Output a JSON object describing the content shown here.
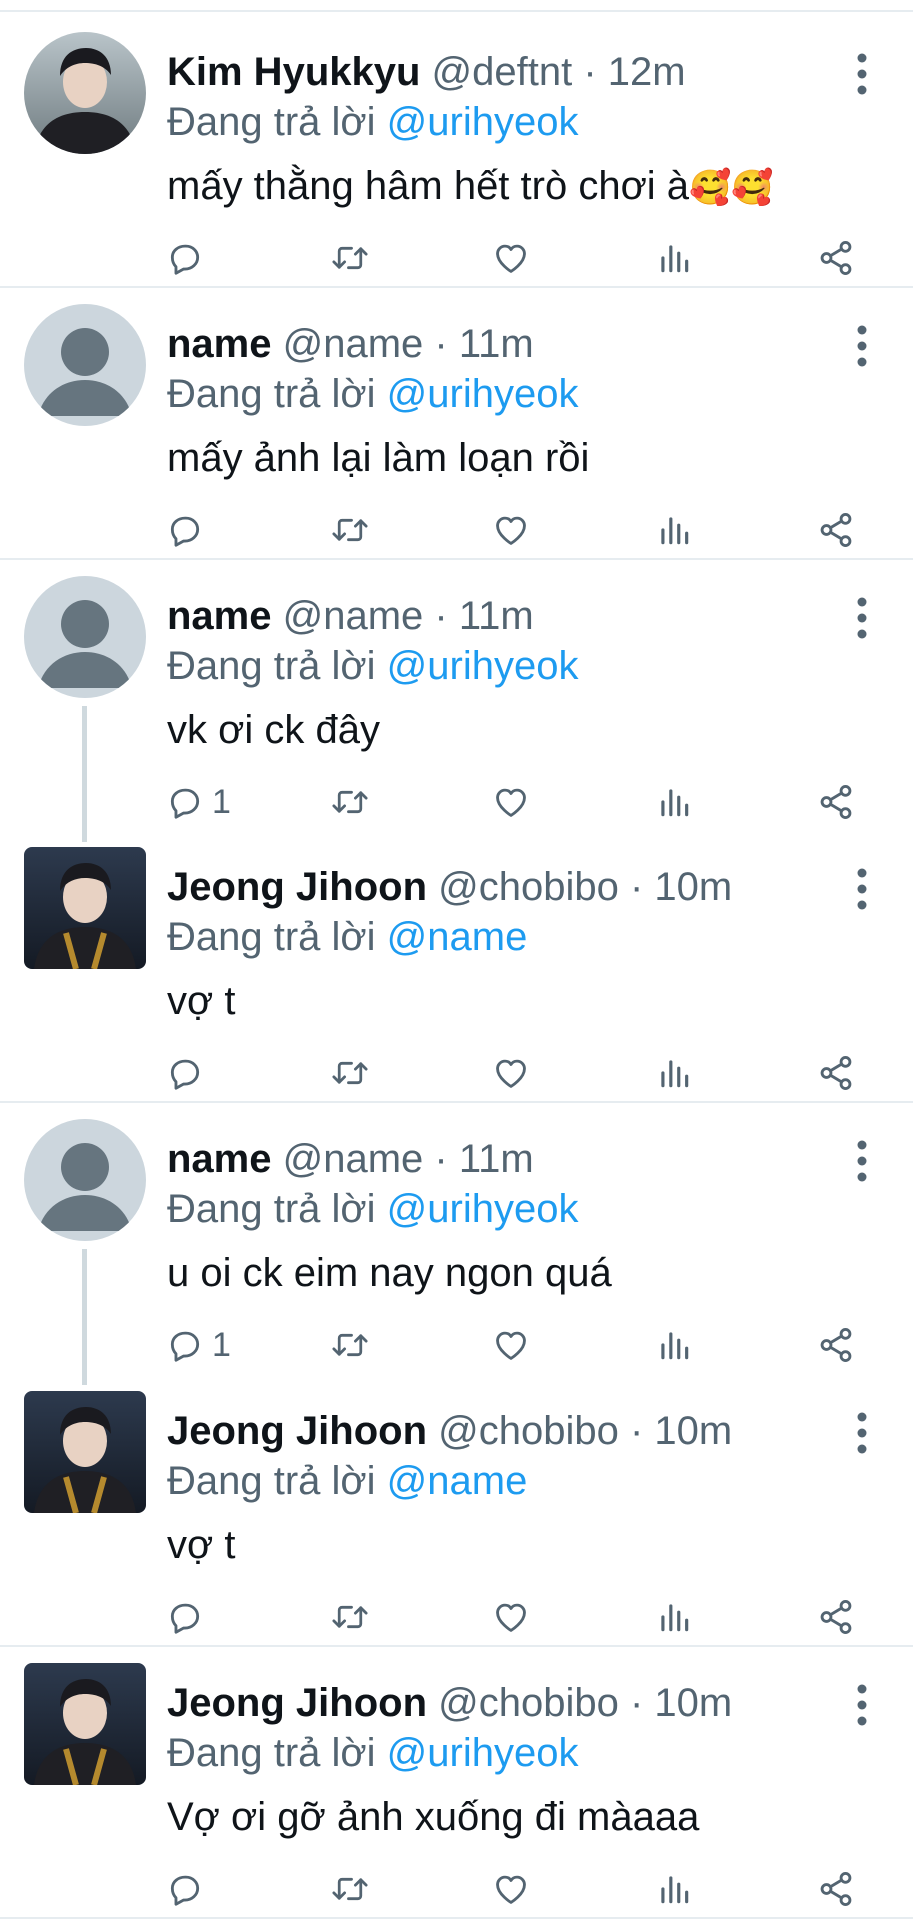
{
  "labels": {
    "replying_prefix": "Đang trả lời ",
    "dot": " · "
  },
  "tweets": [
    {
      "name": "Kim Hyukkyu",
      "handle": "@deftnt",
      "time": "12m",
      "reply_to": "@urihyeok",
      "text": "mấy thằng hâm hết trò chơi à",
      "emoji": "🥰🥰",
      "avatar": "photo-avatar",
      "reply_count": "",
      "thread": false
    },
    {
      "name": "name",
      "handle": "@name",
      "time": "11m",
      "reply_to": "@urihyeok",
      "text": "mấy ảnh lại làm loạn rồi",
      "emoji": "",
      "avatar": "default-avatar",
      "reply_count": "",
      "thread": false
    },
    {
      "name": "name",
      "handle": "@name",
      "time": "11m",
      "reply_to": "@urihyeok",
      "text": "vk ơi ck đây",
      "emoji": "",
      "avatar": "default-avatar",
      "reply_count": "1",
      "thread": true
    },
    {
      "name": "Jeong Jihoon",
      "handle": "@chobibo",
      "time": "10m",
      "reply_to": "@name",
      "text": "vợ t",
      "emoji": "",
      "avatar": "photo-avatar",
      "reply_count": "",
      "thread": false
    },
    {
      "name": "name",
      "handle": "@name",
      "time": "11m",
      "reply_to": "@urihyeok",
      "text": "u oi ck eim nay ngon quá",
      "emoji": "",
      "avatar": "default-avatar",
      "reply_count": "1",
      "thread": true
    },
    {
      "name": "Jeong Jihoon",
      "handle": "@chobibo",
      "time": "10m",
      "reply_to": "@name",
      "text": "vợ t",
      "emoji": "",
      "avatar": "photo-avatar",
      "reply_count": "",
      "thread": false
    },
    {
      "name": "Jeong Jihoon",
      "handle": "@chobibo",
      "time": "10m",
      "reply_to": "@urihyeok",
      "text": "Vợ ơi gỡ ảnh xuống đi màaaa",
      "emoji": "",
      "avatar": "photo-avatar",
      "reply_count": "",
      "thread": false
    }
  ],
  "icons": {
    "reply": "reply-icon",
    "retweet": "retweet-icon",
    "like": "heart-icon",
    "views": "analytics-icon",
    "share": "share-icon",
    "more": "more-vertical-icon"
  },
  "colors": {
    "text": "#0f1419",
    "secondary": "#536471",
    "mention": "#1d9bf0",
    "divider": "#e6ecf0",
    "thread_line": "#cfd9de",
    "default_avatar_bg": "#ccd6dd",
    "default_avatar_fg": "#66757f"
  }
}
